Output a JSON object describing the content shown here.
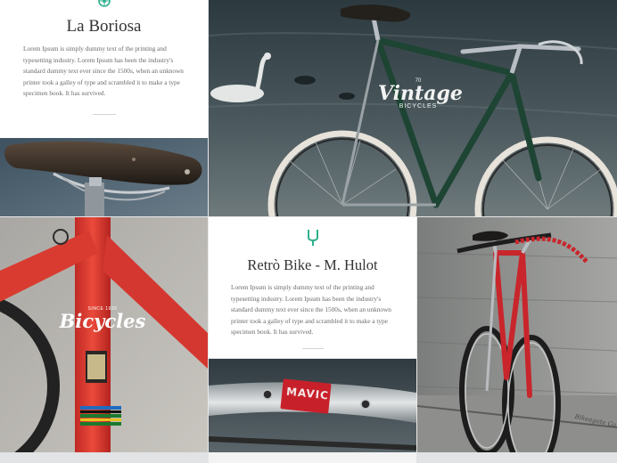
{
  "card1": {
    "title": "La Boriosa",
    "body": "Lorem Ipsum is simply dummy text of the printing and typesetting industry. Lorem Ipsum has been the industry's standard dummy text ever since the 1500s, when an unknown printer took a galley of type and scrambled it to make a type specimen book. It has survived."
  },
  "card2": {
    "title": "Retrò Bike - M. Hulot",
    "body": "Lorem Ipsum is simply dummy text of the printing and typesetting industry. Lorem Ipsum has been the industry's standard dummy text ever since the 1500s, when an unknown printer took a galley of type and scrambled it to make a type specimen book. It has survived."
  },
  "photos": {
    "vintage_logo": {
      "small": "70",
      "main": "Vintage",
      "sub": "BICYCLES"
    },
    "bicycles_logo": {
      "since": "SINCE 1926",
      "main": "Bicycles"
    },
    "rim_brand": "MAVIC",
    "wall_signature": "Bikeagate Co."
  },
  "colors": {
    "accent": "#2fb08e",
    "title": "#333333",
    "text": "#6b6b6b"
  },
  "icons": {
    "card1": "wheel-icon",
    "card2": "tuning-fork-icon"
  }
}
